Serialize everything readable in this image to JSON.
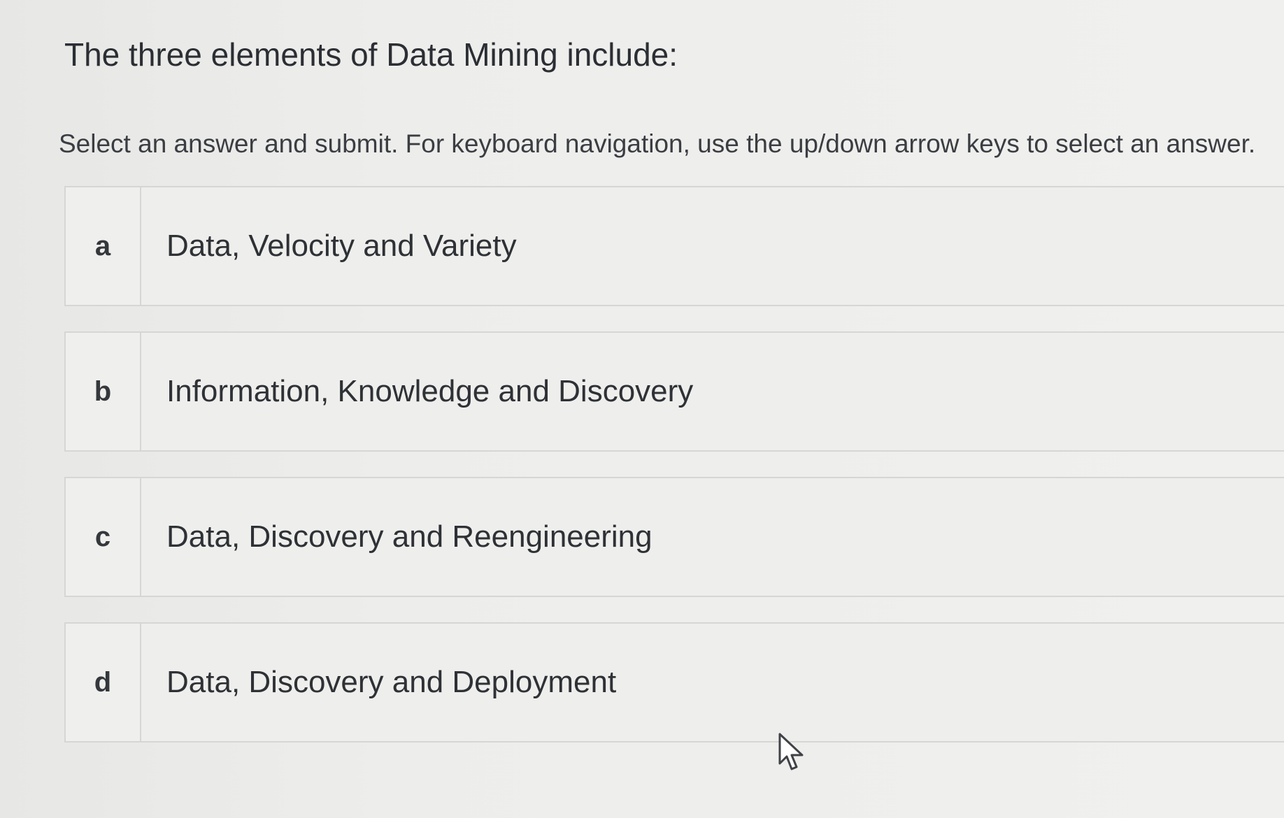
{
  "question": {
    "title": "The three elements of Data Mining include:",
    "instructions": "Select an answer and submit. For keyboard navigation, use the up/down arrow keys to select an answer."
  },
  "options": [
    {
      "letter": "a",
      "text": "Data, Velocity and Variety"
    },
    {
      "letter": "b",
      "text": "Information, Knowledge and Discovery"
    },
    {
      "letter": "c",
      "text": "Data, Discovery and Reengineering"
    },
    {
      "letter": "d",
      "text": "Data, Discovery and Deployment"
    }
  ],
  "cursor": {
    "icon": "mouse-pointer-icon"
  }
}
